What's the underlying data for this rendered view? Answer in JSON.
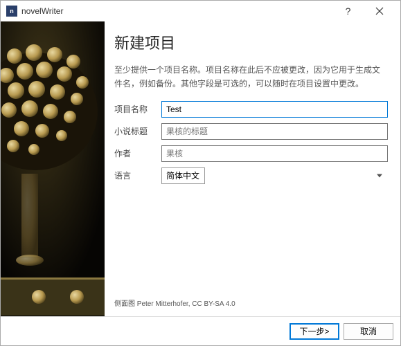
{
  "titlebar": {
    "app_name": "novelWriter",
    "icon_letter": "n"
  },
  "heading": "新建项目",
  "description": "至少提供一个项目名称。项目名称在此后不应被更改，因为它用于生成文件名，例如备份。其他字段是可选的，可以随时在项目设置中更改。",
  "form": {
    "project_name": {
      "label": "项目名称",
      "value": "Test"
    },
    "novel_title": {
      "label": "小说标题",
      "placeholder": "果核的标题",
      "value": ""
    },
    "author": {
      "label": "作者",
      "placeholder": "果核",
      "value": ""
    },
    "language": {
      "label": "语言",
      "value": "简体中文"
    }
  },
  "credit": "侧面图 Peter Mitterhofer, CC BY-SA 4.0",
  "buttons": {
    "next": "下一步>",
    "cancel": "取消"
  }
}
